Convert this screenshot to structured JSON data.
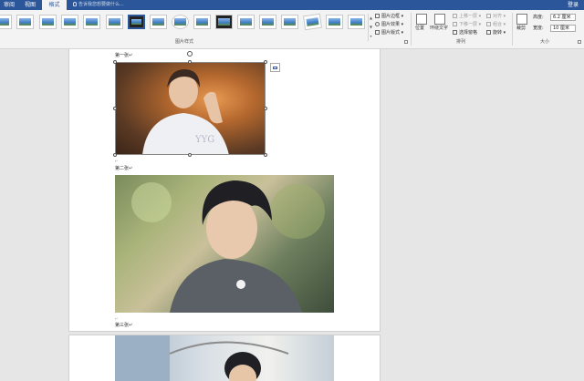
{
  "tabs": [
    {
      "label": "审阅",
      "active": false
    },
    {
      "label": "视图",
      "active": false
    },
    {
      "label": "格式",
      "active": true
    }
  ],
  "tell_me": {
    "placeholder": "告诉我您想要做什么..."
  },
  "account": {
    "login_label": "登录"
  },
  "ribbon": {
    "picture_styles": {
      "group_label": "图片样式",
      "thumbnails": [
        "simple-frame-white",
        "simple-frame-black",
        "beveled-matte",
        "drop-shadow",
        "rounded-diagonal",
        "thick-black-frame",
        "center-shadow",
        "oval-frame",
        "soft-edge",
        "double-frame",
        "thick-matte",
        "shadow-rectangle",
        "perspective",
        "tilted-white"
      ],
      "border_label": "图片边框",
      "effects_label": "图片效果",
      "layout_label": "图片版式"
    },
    "arrange": {
      "group_label": "排列",
      "position_label": "位置",
      "wrap_text_label": "环绕文字",
      "bring_forward_label": "上移一层",
      "send_backward_label": "下移一层",
      "selection_pane_label": "选择窗格",
      "align_label": "对齐",
      "group_label_cmd": "组合",
      "rotate_label": "旋转"
    },
    "size": {
      "group_label": "大小",
      "crop_label": "裁剪",
      "height_label": "高度:",
      "height_value": "6.2 厘米",
      "width_label": "宽度:",
      "width_value": "10 厘米"
    }
  },
  "document": {
    "paragraphs": [
      "第一张↵",
      "第二张↵",
      "第三张↵"
    ]
  },
  "colors": {
    "accent": "#2b579a",
    "ribbon_bg": "#f3f3f3",
    "doc_bg": "#e6e6e6"
  }
}
